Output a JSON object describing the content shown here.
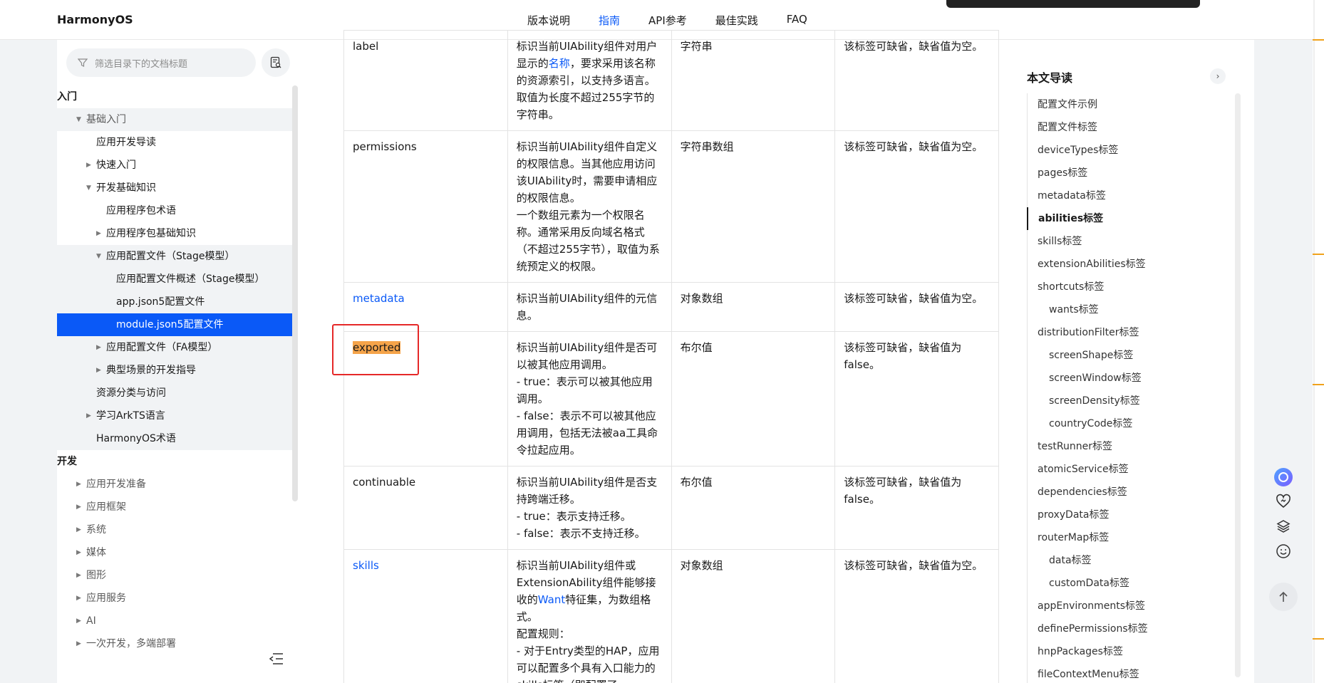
{
  "header": {
    "brand": "HarmonyOS",
    "nav": [
      {
        "label": "版本说明",
        "active": false
      },
      {
        "label": "指南",
        "active": true
      },
      {
        "label": "API参考",
        "active": false
      },
      {
        "label": "最佳实践",
        "active": false
      },
      {
        "label": "FAQ",
        "active": false
      }
    ]
  },
  "sidebar": {
    "filter_placeholder": "筛选目录下的文档标题",
    "tree": [
      {
        "label": "入门",
        "level": 0,
        "type": "section",
        "arrow": ""
      },
      {
        "label": "基础入门",
        "level": 1,
        "arrow": "down",
        "style": "shade muted"
      },
      {
        "label": "应用开发导读",
        "level": 2,
        "arrow": ""
      },
      {
        "label": "快速入门",
        "level": 2,
        "arrow": "right"
      },
      {
        "label": "开发基础知识",
        "level": 2,
        "arrow": "down"
      },
      {
        "label": "应用程序包术语",
        "level": 3,
        "arrow": ""
      },
      {
        "label": "应用程序包基础知识",
        "level": 3,
        "arrow": "right"
      },
      {
        "label": "应用配置文件（Stage模型）",
        "level": 3,
        "arrow": "down",
        "style": "shade"
      },
      {
        "label": "应用配置文件概述（Stage模型）",
        "level": 4,
        "arrow": "",
        "style": "shade"
      },
      {
        "label": "app.json5配置文件",
        "level": 4,
        "arrow": "",
        "style": "shade"
      },
      {
        "label": "module.json5配置文件",
        "level": 4,
        "arrow": "",
        "style": "selected"
      },
      {
        "label": "应用配置文件（FA模型）",
        "level": 3,
        "arrow": "right",
        "style": "shade"
      },
      {
        "label": "典型场景的开发指导",
        "level": 3,
        "arrow": "right",
        "style": "shade"
      },
      {
        "label": "资源分类与访问",
        "level": 2,
        "arrow": "",
        "style": "shade"
      },
      {
        "label": "学习ArkTS语言",
        "level": 2,
        "arrow": "right",
        "style": "shade"
      },
      {
        "label": "HarmonyOS术语",
        "level": 2,
        "arrow": "",
        "style": "shade"
      },
      {
        "label": "开发",
        "level": 0,
        "type": "section",
        "arrow": ""
      },
      {
        "label": "应用开发准备",
        "level": 1,
        "arrow": "right",
        "style": "muted"
      },
      {
        "label": "应用框架",
        "level": 1,
        "arrow": "right",
        "style": "muted"
      },
      {
        "label": "系统",
        "level": 1,
        "arrow": "right",
        "style": "muted"
      },
      {
        "label": "媒体",
        "level": 1,
        "arrow": "right",
        "style": "muted"
      },
      {
        "label": "图形",
        "level": 1,
        "arrow": "right",
        "style": "muted"
      },
      {
        "label": "应用服务",
        "level": 1,
        "arrow": "right",
        "style": "muted"
      },
      {
        "label": "AI",
        "level": 1,
        "arrow": "right",
        "style": "muted"
      },
      {
        "label": "一次开发，多端部署",
        "level": 1,
        "arrow": "right",
        "style": "muted"
      }
    ]
  },
  "table": {
    "rows": [
      {
        "name": "label",
        "name_link": false,
        "desc": [
          "标识当前UIAbility组件对用户显示的名称，要求采用该名称的资源索引，以支持多语言。取值为长度不超过255字节的字符串。"
        ],
        "desc_link_word": "名称",
        "type": "字符串",
        "note": "该标签可缺省，缺省值为空。"
      },
      {
        "name": "permissions",
        "name_link": false,
        "desc": [
          "标识当前UIAbility组件自定义的权限信息。当其他应用访问该UIAbility时，需要申请相应的权限信息。",
          "一个数组元素为一个权限名称。通常采用反向域名格式（不超过255字节），取值为系统预定义的权限。"
        ],
        "type": "字符串数组",
        "note": "该标签可缺省，缺省值为空。"
      },
      {
        "name": "metadata",
        "name_link": true,
        "desc": [
          "标识当前UIAbility组件的元信息。"
        ],
        "type": "对象数组",
        "note": "该标签可缺省，缺省值为空。"
      },
      {
        "name": "exported",
        "name_link": false,
        "highlight": true,
        "desc": [
          "标识当前UIAbility组件是否可以被其他应用调用。",
          "- true：表示可以被其他应用调用。",
          "- false：表示不可以被其他应用调用，包括无法被aa工具命令拉起应用。"
        ],
        "type": "布尔值",
        "note": "该标签可缺省，缺省值为false。"
      },
      {
        "name": "continuable",
        "name_link": false,
        "desc": [
          "标识当前UIAbility组件是否支持跨端迁移。",
          "- true：表示支持迁移。",
          "- false：表示不支持迁移。"
        ],
        "type": "布尔值",
        "note": "该标签可缺省，缺省值为false。"
      },
      {
        "name": "skills",
        "name_link": true,
        "desc": [
          "标识当前UIAbility组件或ExtensionAbility组件能够接收的Want特征集，为数组格式。",
          "配置规则：",
          "- 对于Entry类型的HAP，应用可以配置多个具有入口能力的skills标签（即配置了"
        ],
        "desc_link_word": "Want",
        "type": "对象数组",
        "note": "该标签可缺省，缺省值为空。"
      }
    ]
  },
  "toc": {
    "title": "本文导读",
    "items": [
      {
        "label": "配置文件示例",
        "sub": false
      },
      {
        "label": "配置文件标签",
        "sub": false
      },
      {
        "label": "deviceTypes标签",
        "sub": false
      },
      {
        "label": "pages标签",
        "sub": false
      },
      {
        "label": "metadata标签",
        "sub": false
      },
      {
        "label": "abilities标签",
        "sub": false,
        "active": true
      },
      {
        "label": "skills标签",
        "sub": false
      },
      {
        "label": "extensionAbilities标签",
        "sub": false
      },
      {
        "label": "shortcuts标签",
        "sub": false
      },
      {
        "label": "wants标签",
        "sub": true
      },
      {
        "label": "distributionFilter标签",
        "sub": false
      },
      {
        "label": "screenShape标签",
        "sub": true
      },
      {
        "label": "screenWindow标签",
        "sub": true
      },
      {
        "label": "screenDensity标签",
        "sub": true
      },
      {
        "label": "countryCode标签",
        "sub": true
      },
      {
        "label": "testRunner标签",
        "sub": false
      },
      {
        "label": "atomicService标签",
        "sub": false
      },
      {
        "label": "dependencies标签",
        "sub": false
      },
      {
        "label": "proxyData标签",
        "sub": false
      },
      {
        "label": "routerMap标签",
        "sub": false
      },
      {
        "label": "data标签",
        "sub": true
      },
      {
        "label": "customData标签",
        "sub": true
      },
      {
        "label": "appEnvironments标签",
        "sub": false
      },
      {
        "label": "definePermissions标签",
        "sub": false
      },
      {
        "label": "hnpPackages标签",
        "sub": false
      },
      {
        "label": "fileContextMenu标签",
        "sub": false
      }
    ]
  },
  "floating": [
    "assistant-icon",
    "favorite-icon",
    "layers-icon",
    "feedback-icon"
  ],
  "colors": {
    "accent": "#0a59f7",
    "highlight": "#f5a44a",
    "box": "#e52828"
  }
}
